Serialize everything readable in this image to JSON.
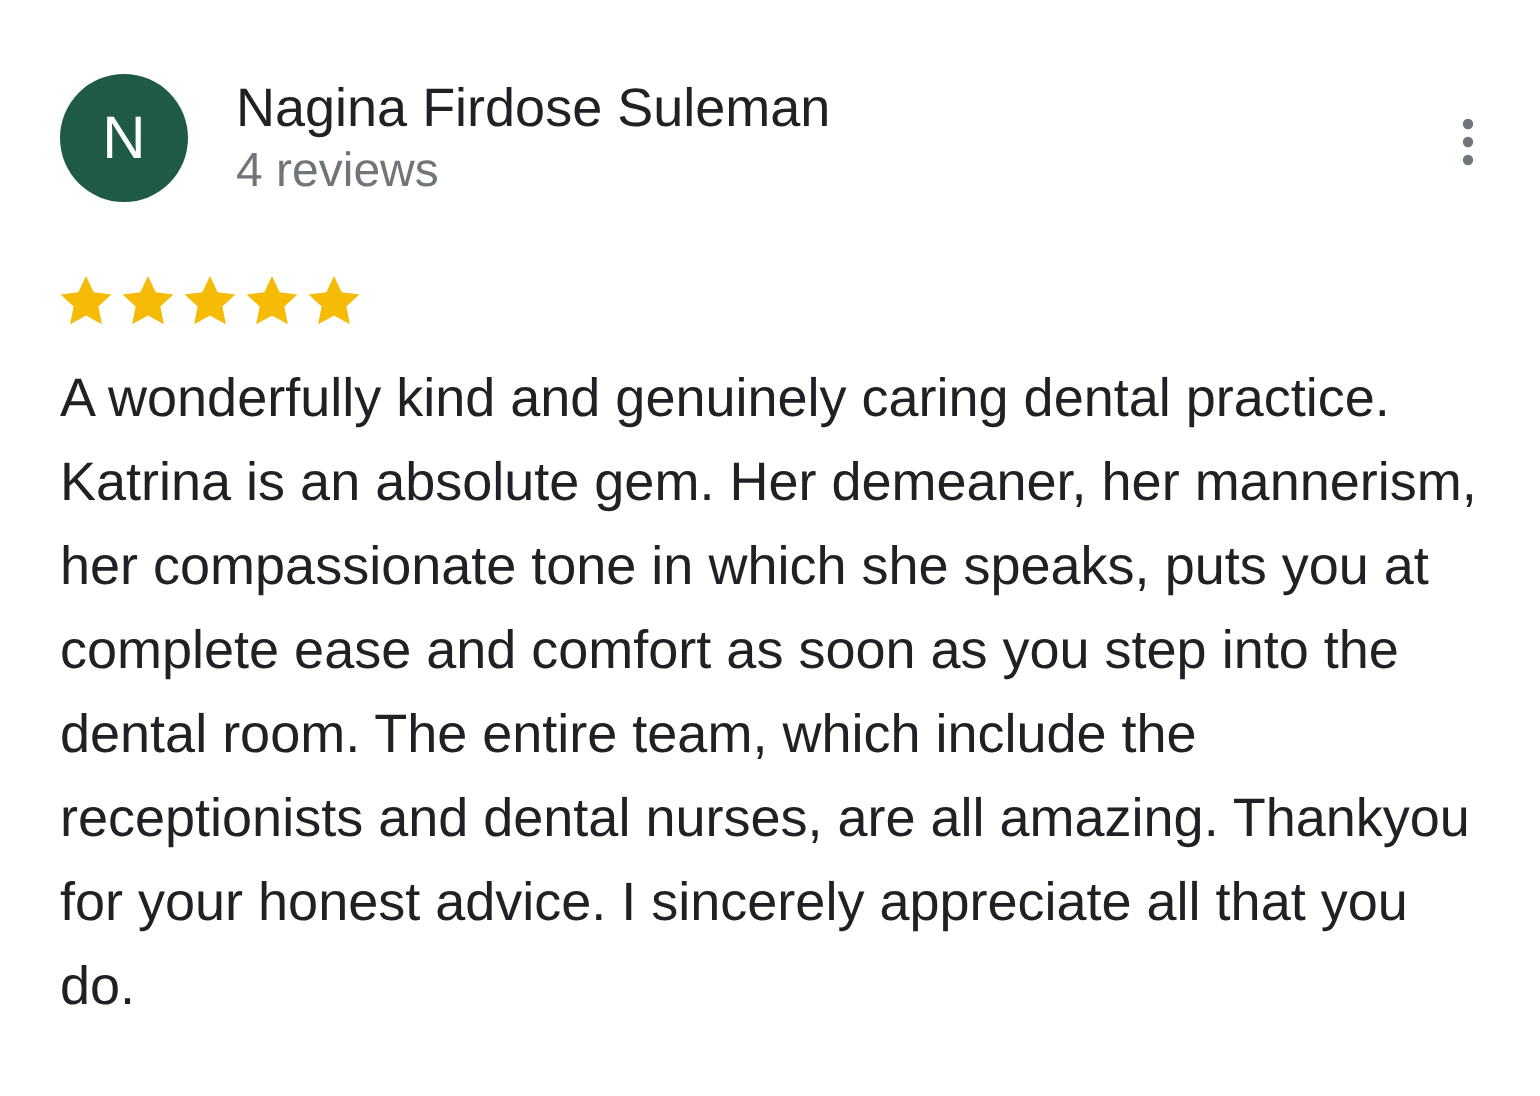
{
  "review": {
    "avatar_letter": "N",
    "author": "Nagina Firdose Suleman",
    "review_count": "4 reviews",
    "stars": 5,
    "text": "A wonderfully kind and genuinely caring dental practice. Katrina is an absolute gem. Her demeaner, her mannerism, her compassionate tone in which she speaks, puts you at complete ease and comfort as soon as you step into the dental room. The entire team, which include the receptionists and dental nurses, are all amazing. Thankyou for your honest advice. I sincerely appreciate all that you do."
  }
}
